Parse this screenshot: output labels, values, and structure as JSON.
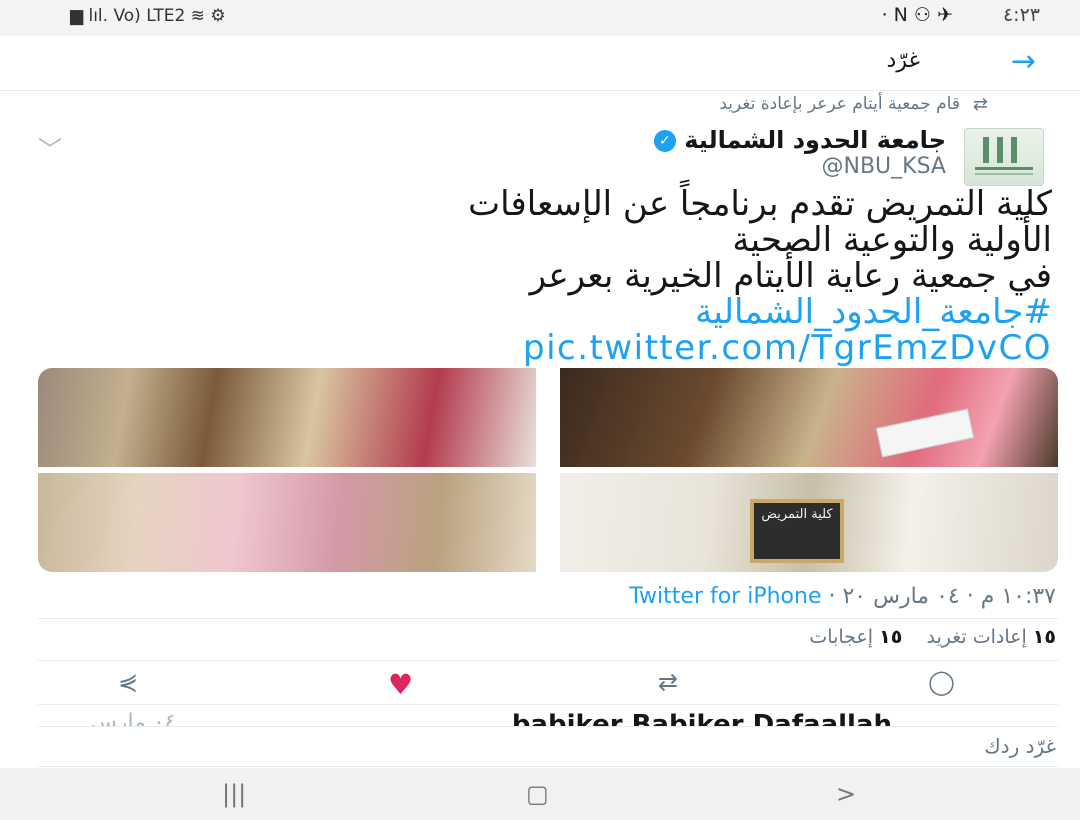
{
  "status_bar": {
    "left_icons": "▆ lıl. Vo) LTE2 ≋ ⚙",
    "right_icons": "· N ⚇ ✈",
    "time": "٤:٢٣"
  },
  "header": {
    "title": "غرّد",
    "back_icon": "arrow-right-icon"
  },
  "retweet_note": "قام جمعية أيتام عرعر بإعادة تغريد",
  "author": {
    "name": "جامعة الحدود الشمالية",
    "handle": "@NBU_KSA"
  },
  "tweet": {
    "line1": "كلية التمريض تقدم برنامجاً عن الإسعافات",
    "line2": "الأولية والتوعية الصحية",
    "line3": "في جمعية رعاية الأيتام الخيرية بعرعر",
    "hashtag": "#جامعة_الحدود_الشمالية",
    "pic_link": "pic.twitter.com/TgrEmzDvCO"
  },
  "media": {
    "chalkboard_text": "كلية التمريض"
  },
  "meta": {
    "time": "١٠:٣٧ م",
    "date": "٠٤ مارس ٢٠",
    "sep": " · ",
    "source": "Twitter for iPhone"
  },
  "stats": {
    "retweets_count": "١٥",
    "retweets_label": "إعادات تغريد",
    "likes_count": "١٥",
    "likes_label": "إعجابات"
  },
  "peek": {
    "name": "babiker Babiker Dafaallah",
    "date": "٠٤ مارس"
  },
  "reply_placeholder": "غرّد ردك",
  "nav": {
    "recent": "|||",
    "home": "▢",
    "back": ">"
  }
}
